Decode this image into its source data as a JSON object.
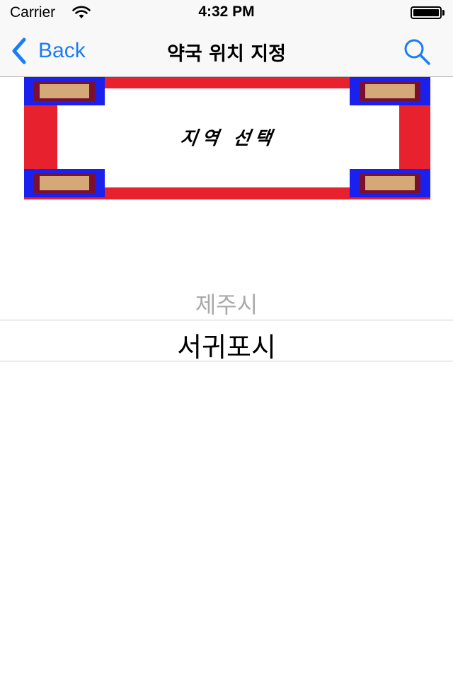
{
  "status_bar": {
    "carrier": "Carrier",
    "time": "4:32 PM",
    "wifi_icon": "wifi-icon",
    "battery_icon": "battery-full-icon"
  },
  "nav_bar": {
    "back_label": "Back",
    "title": "약국 위치 지정",
    "back_icon": "chevron-left-icon",
    "search_icon": "search-icon",
    "accent_color": "#1a7cf6"
  },
  "banner": {
    "text": "지역 선택",
    "colors": {
      "frame": "#e8212f",
      "corner": "#1a20ee",
      "corner_inner": "#d4a877",
      "corner_border": "#7a1030"
    }
  },
  "picker": {
    "options": [
      "제주시",
      "서귀포시"
    ],
    "selected": "서귀포시"
  }
}
